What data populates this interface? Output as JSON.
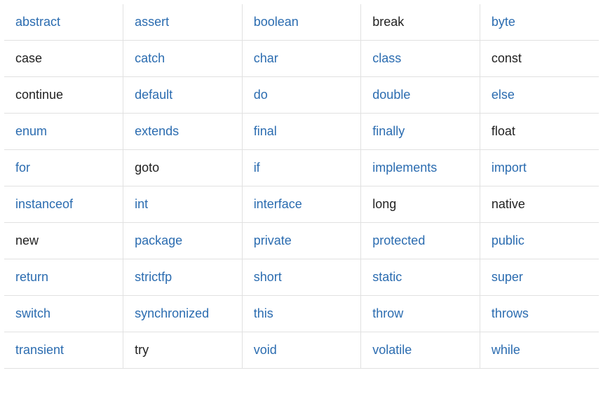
{
  "table": {
    "rows": [
      [
        {
          "text": "abstract",
          "link": true
        },
        {
          "text": "assert",
          "link": true
        },
        {
          "text": "boolean",
          "link": true
        },
        {
          "text": "break",
          "link": false
        },
        {
          "text": "byte",
          "link": true
        }
      ],
      [
        {
          "text": "case",
          "link": false
        },
        {
          "text": "catch",
          "link": true
        },
        {
          "text": "char",
          "link": true
        },
        {
          "text": "class",
          "link": true
        },
        {
          "text": "const",
          "link": false
        }
      ],
      [
        {
          "text": "continue",
          "link": false
        },
        {
          "text": "default",
          "link": true
        },
        {
          "text": "do",
          "link": true
        },
        {
          "text": "double",
          "link": true
        },
        {
          "text": "else",
          "link": true
        }
      ],
      [
        {
          "text": "enum",
          "link": true
        },
        {
          "text": "extends",
          "link": true
        },
        {
          "text": "final",
          "link": true
        },
        {
          "text": "finally",
          "link": true
        },
        {
          "text": "float",
          "link": false
        }
      ],
      [
        {
          "text": "for",
          "link": true
        },
        {
          "text": "goto",
          "link": false
        },
        {
          "text": "if",
          "link": true
        },
        {
          "text": "implements",
          "link": true
        },
        {
          "text": "import",
          "link": true
        }
      ],
      [
        {
          "text": "instanceof",
          "link": true
        },
        {
          "text": "int",
          "link": true
        },
        {
          "text": "interface",
          "link": true
        },
        {
          "text": "long",
          "link": false
        },
        {
          "text": "native",
          "link": false
        }
      ],
      [
        {
          "text": "new",
          "link": false
        },
        {
          "text": "package",
          "link": true
        },
        {
          "text": "private",
          "link": true
        },
        {
          "text": "protected",
          "link": true
        },
        {
          "text": "public",
          "link": true
        }
      ],
      [
        {
          "text": "return",
          "link": true
        },
        {
          "text": "strictfp",
          "link": true
        },
        {
          "text": "short",
          "link": true
        },
        {
          "text": "static",
          "link": true
        },
        {
          "text": "super",
          "link": true
        }
      ],
      [
        {
          "text": "switch",
          "link": true
        },
        {
          "text": "synchronized",
          "link": true
        },
        {
          "text": "this",
          "link": true
        },
        {
          "text": "throw",
          "link": true
        },
        {
          "text": "throws",
          "link": true
        }
      ],
      [
        {
          "text": "transient",
          "link": true
        },
        {
          "text": "try",
          "link": false
        },
        {
          "text": "void",
          "link": true
        },
        {
          "text": "volatile",
          "link": true
        },
        {
          "text": "while",
          "link": true
        }
      ]
    ]
  }
}
